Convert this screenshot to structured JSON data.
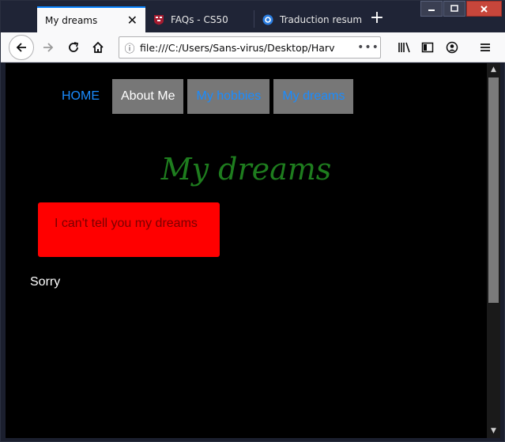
{
  "browser": {
    "tabs": [
      {
        "title": "My dreams",
        "active": true
      },
      {
        "title": "FAQs - CS50",
        "active": false
      },
      {
        "title": "Traduction resum",
        "active": false
      }
    ],
    "new_tab_glyph": "+",
    "close_glyph": "✕",
    "url": "file:///C:/Users/Sans-virus/Desktop/Harv",
    "url_menu_glyph": "•••",
    "accent_color": "#0a84ff"
  },
  "page": {
    "nav": [
      {
        "label": "HOME",
        "style": "plain"
      },
      {
        "label": "About Me",
        "style": "boxed-current"
      },
      {
        "label": "My hobbies",
        "style": "boxed"
      },
      {
        "label": "My dreams",
        "style": "boxed"
      }
    ],
    "heading": "My dreams",
    "dream_box_text": "I can't tell you my dreams",
    "footer_text": "Sorry",
    "colors": {
      "background": "#000000",
      "link": "#1a8cff",
      "heading": "#1e7d1e",
      "dream_box": "#ff0000",
      "nav_box": "#777777"
    }
  }
}
